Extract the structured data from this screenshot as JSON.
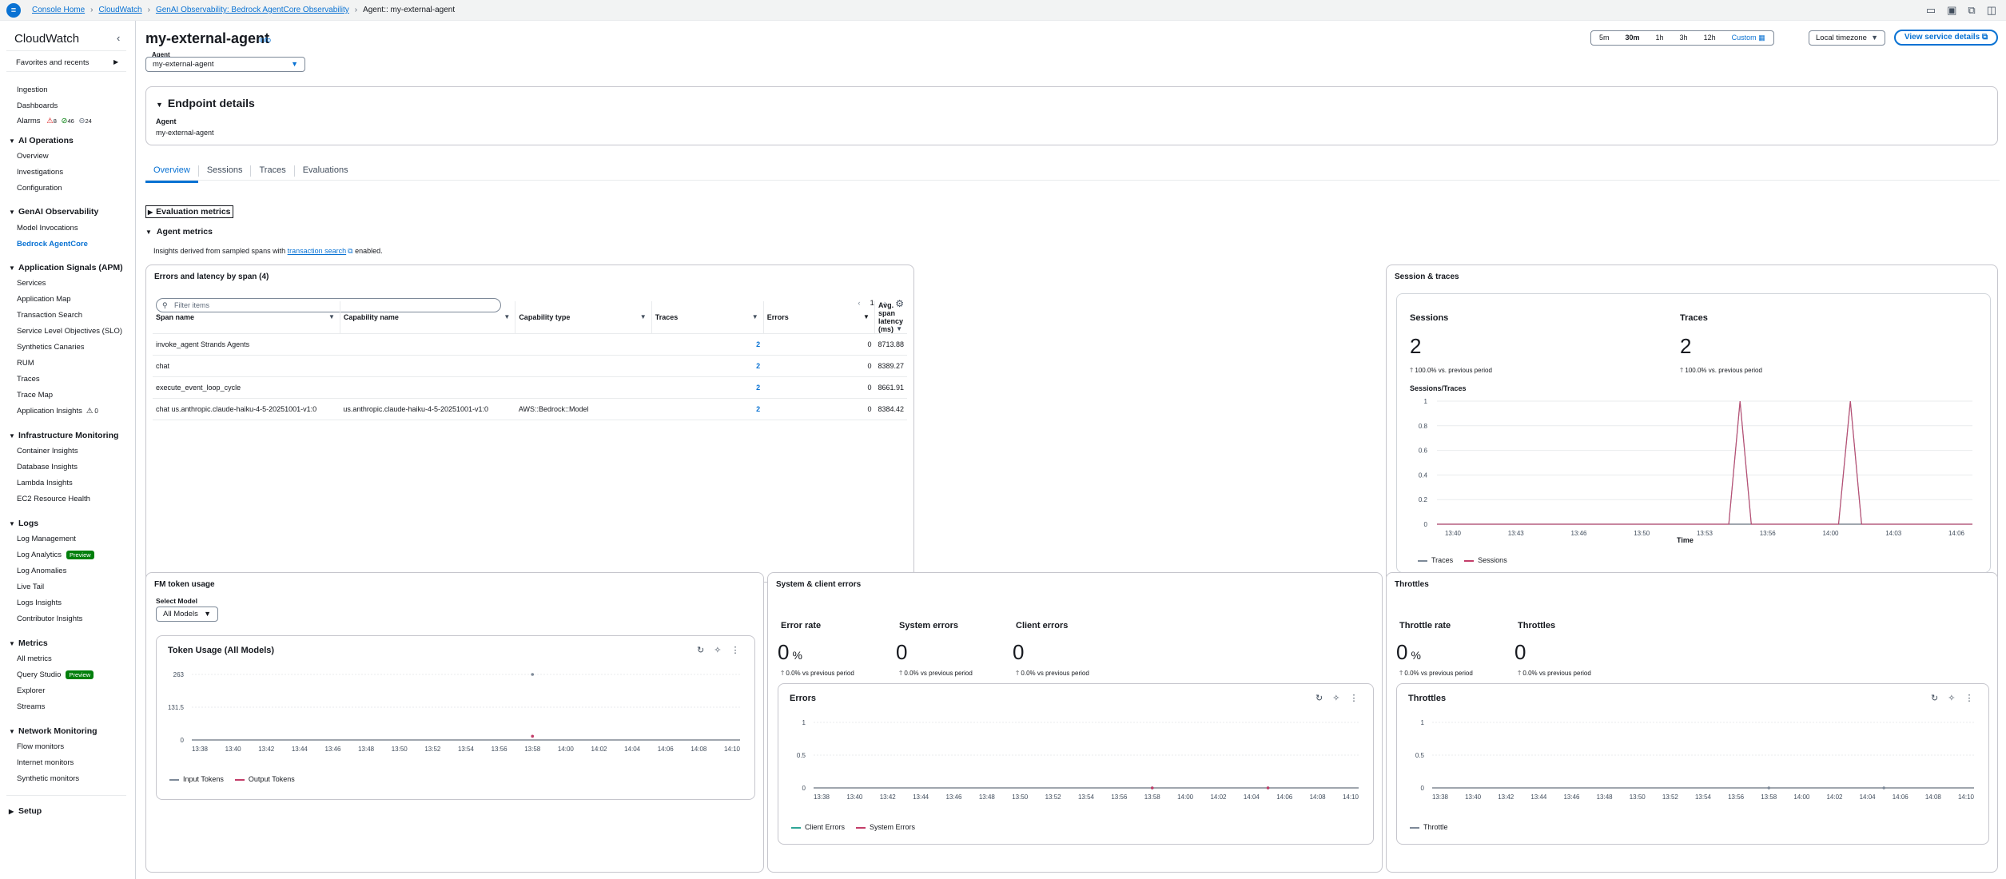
{
  "topbar": {
    "menu_icon": "menu-icon",
    "crumbs": [
      "Console Home",
      "CloudWatch",
      "GenAI Observability: Bedrock AgentCore Observability",
      "Agent:: my-external-agent"
    ]
  },
  "sidebar": {
    "title": "CloudWatch",
    "favorites": "Favorites and recents",
    "top_items": [
      "Ingestion",
      "Dashboards"
    ],
    "alarms": {
      "label": "Alarms",
      "in_alarm": "8",
      "ok": "46",
      "insufficient": "24"
    },
    "sections": [
      {
        "title": "AI Operations",
        "items": [
          "Overview",
          "Investigations",
          "Configuration"
        ]
      },
      {
        "title": "GenAI Observability",
        "items": [
          "Model Invocations",
          "Bedrock AgentCore"
        ]
      },
      {
        "title": "Application Signals (APM)",
        "items": [
          "Services",
          "Application Map",
          "Transaction Search",
          "Service Level Objectives (SLO)",
          "Synthetics Canaries",
          "RUM",
          "Traces",
          "Trace Map",
          "Application Insights"
        ]
      },
      {
        "title": "Infrastructure Monitoring",
        "items": [
          "Container Insights",
          "Database Insights",
          "Lambda Insights",
          "EC2 Resource Health"
        ]
      },
      {
        "title": "Logs",
        "items": [
          "Log Management",
          "Log Analytics",
          "Log Anomalies",
          "Live Tail",
          "Logs Insights",
          "Contributor Insights"
        ]
      },
      {
        "title": "Metrics",
        "items": [
          "All metrics",
          "Query Studio",
          "Explorer",
          "Streams"
        ]
      },
      {
        "title": "Network Monitoring",
        "items": [
          "Flow monitors",
          "Internet monitors",
          "Synthetic monitors"
        ]
      },
      {
        "title": "Setup",
        "items": []
      }
    ],
    "app_insights_count": "0",
    "preview_badge": "Preview"
  },
  "header": {
    "title": "my-external-agent",
    "info": "Info",
    "agent_label": "Agent",
    "agent_value": "my-external-agent"
  },
  "timerange": {
    "options": [
      "5m",
      "30m",
      "1h",
      "3h",
      "12h",
      "Custom"
    ],
    "selected": "30m",
    "timezone": "Local timezone",
    "view_service": "View service details"
  },
  "endpoint": {
    "title": "Endpoint details",
    "agent_label": "Agent",
    "agent_value": "my-external-agent"
  },
  "tabs": [
    "Overview",
    "Sessions",
    "Traces",
    "Evaluations"
  ],
  "sections": {
    "eval": "Evaluation metrics",
    "agent": "Agent metrics",
    "note_pre": "Insights derived from sampled spans with",
    "note_link": "transaction search",
    "note_post": "enabled."
  },
  "errors_table": {
    "title": "Errors and latency by span (4)",
    "filter_placeholder": "Filter items",
    "page": "1",
    "columns": [
      "Span name",
      "Capability name",
      "Capability type",
      "Traces",
      "Errors",
      "Avg. span latency (ms)"
    ],
    "rows": [
      [
        "invoke_agent Strands Agents",
        "",
        "",
        "2",
        "0",
        "8713.88"
      ],
      [
        "chat",
        "",
        "",
        "2",
        "0",
        "8389.27"
      ],
      [
        "execute_event_loop_cycle",
        "",
        "",
        "2",
        "0",
        "8661.91"
      ],
      [
        "chat us.anthropic.claude-haiku-4-5-20251001-v1:0",
        "us.anthropic.claude-haiku-4-5-20251001-v1:0",
        "AWS::Bedrock::Model",
        "2",
        "0",
        "8384.42"
      ]
    ]
  },
  "session_traces": {
    "title": "Session & traces",
    "sessions_label": "Sessions",
    "sessions_value": "2",
    "sessions_delta": "100.0% vs. previous period",
    "traces_label": "Traces",
    "traces_value": "2",
    "traces_delta": "100.0% vs. previous period",
    "chart_title": "Sessions/Traces",
    "xlabel": "Time"
  },
  "fm_tokens": {
    "title": "FM token usage",
    "select_label": "Select Model",
    "select_value": "All Models",
    "chart_title": "Token Usage (All Models)"
  },
  "sys_errors": {
    "title": "System & client errors",
    "kpis": [
      {
        "label": "Error rate",
        "value": "0",
        "unit": "%",
        "delta": "0.0% vs previous period"
      },
      {
        "label": "System errors",
        "value": "0",
        "unit": "",
        "delta": "0.0% vs previous period"
      },
      {
        "label": "Client errors",
        "value": "0",
        "unit": "",
        "delta": "0.0% vs previous period"
      }
    ],
    "chart_title": "Errors"
  },
  "throttles": {
    "title": "Throttles",
    "kpis": [
      {
        "label": "Throttle rate",
        "value": "0",
        "unit": "%",
        "delta": "0.0% vs previous period"
      },
      {
        "label": "Throttles",
        "value": "0",
        "unit": "",
        "delta": "0.0% vs previous period"
      }
    ],
    "chart_title": "Throttles"
  },
  "colors": {
    "link": "#0972d3",
    "traces": "#7d8998",
    "sessions": "#c33d69",
    "input": "#7d8998",
    "output": "#c33d69",
    "badge": "#037f0c"
  },
  "chart_data": [
    {
      "type": "line",
      "title": "Sessions/Traces",
      "xlabel": "Time",
      "ylabel": "",
      "ylim": [
        0,
        1
      ],
      "yticks": [
        0,
        0.2,
        0.4,
        0.6,
        0.8,
        1
      ],
      "x": [
        "13:40",
        "13:43",
        "13:46",
        "13:50",
        "13:53",
        "13:56",
        "14:00",
        "14:03",
        "14:06"
      ],
      "series": [
        {
          "name": "Traces",
          "points": [
            [
              0,
              0
            ],
            [
              0.545,
              0
            ],
            [
              0.566,
              1
            ],
            [
              0.587,
              0
            ],
            [
              0.75,
              0
            ],
            [
              0.772,
              1
            ],
            [
              0.793,
              0
            ],
            [
              1,
              0
            ]
          ]
        },
        {
          "name": "Sessions",
          "points": [
            [
              0,
              0
            ],
            [
              0.545,
              0
            ],
            [
              0.566,
              1
            ],
            [
              0.587,
              0
            ],
            [
              0.75,
              0
            ],
            [
              0.772,
              1
            ],
            [
              0.793,
              0
            ],
            [
              1,
              0
            ]
          ]
        }
      ]
    },
    {
      "type": "scatter",
      "title": "Token Usage (All Models)",
      "ylim": [
        0,
        263
      ],
      "yticks": [
        0,
        131.5,
        263
      ],
      "x": [
        "13:38",
        "13:40",
        "13:42",
        "13:44",
        "13:46",
        "13:48",
        "13:50",
        "13:52",
        "13:54",
        "13:56",
        "13:58",
        "14:00",
        "14:02",
        "14:04",
        "14:06",
        "14:08",
        "14:10"
      ],
      "series": [
        {
          "name": "Input Tokens",
          "points": [
            [
              "13:58",
              263
            ]
          ]
        },
        {
          "name": "Output Tokens",
          "points": [
            [
              "13:58",
              15
            ]
          ]
        }
      ]
    },
    {
      "type": "scatter",
      "title": "Errors",
      "ylim": [
        0,
        1
      ],
      "yticks": [
        0,
        0.5,
        1
      ],
      "x": [
        "13:38",
        "13:40",
        "13:42",
        "13:44",
        "13:46",
        "13:48",
        "13:50",
        "13:52",
        "13:54",
        "13:56",
        "13:58",
        "14:00",
        "14:02",
        "14:04",
        "14:06",
        "14:08",
        "14:10"
      ],
      "series": [
        {
          "name": "Client Errors",
          "points": [
            [
              "13:58",
              0
            ],
            [
              "14:05",
              0
            ]
          ]
        },
        {
          "name": "System Errors",
          "points": [
            [
              "13:58",
              0
            ],
            [
              "14:05",
              0
            ]
          ]
        }
      ]
    },
    {
      "type": "scatter",
      "title": "Throttles",
      "ylim": [
        0,
        1
      ],
      "yticks": [
        0,
        0.5,
        1
      ],
      "x": [
        "13:38",
        "13:40",
        "13:42",
        "13:44",
        "13:46",
        "13:48",
        "13:50",
        "13:52",
        "13:54",
        "13:56",
        "13:58",
        "14:00",
        "14:02",
        "14:04",
        "14:06",
        "14:08",
        "14:10"
      ],
      "series": [
        {
          "name": "Throttle",
          "points": [
            [
              "13:58",
              0
            ],
            [
              "14:05",
              0
            ]
          ]
        }
      ]
    }
  ]
}
